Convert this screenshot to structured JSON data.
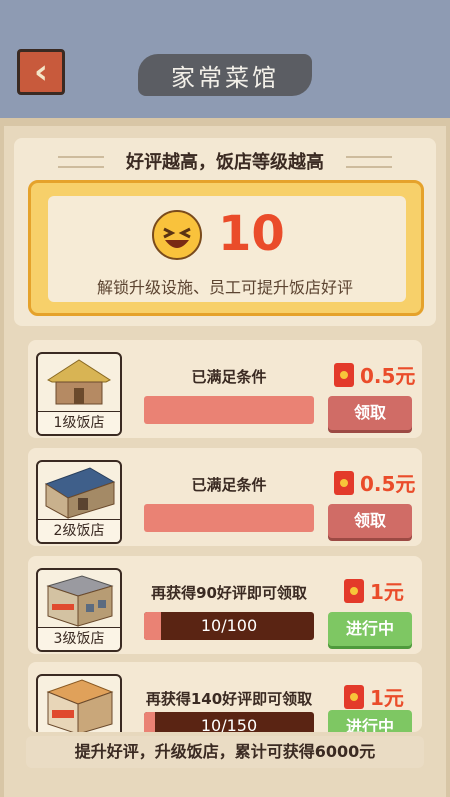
{
  "header": {
    "title": "家常菜馆",
    "back_icon": "chevron-left-icon"
  },
  "summary": {
    "title": "好评越高，饭店等级越高",
    "score": "10",
    "score_icon": "laughing-face-icon",
    "hint": "解锁升级设施、员工可提升饭店好评"
  },
  "cards": [
    {
      "label": "1级饭店",
      "condition": "已满足条件",
      "reward": "0.5元",
      "button": "领取",
      "state": "ready",
      "progress_text": "",
      "progress": 1.0
    },
    {
      "label": "2级饭店",
      "condition": "已满足条件",
      "reward": "0.5元",
      "button": "领取",
      "state": "ready",
      "progress_text": "",
      "progress": 1.0
    },
    {
      "label": "3级饭店",
      "condition": "再获得90好评即可领取",
      "reward": "1元",
      "button": "进行中",
      "state": "in_progress",
      "progress_text": "10/100",
      "progress": 0.1
    },
    {
      "label": "",
      "condition": "再获得140好评即可领取",
      "reward": "1元",
      "button": "进行中",
      "state": "in_progress",
      "progress_text": "10/150",
      "progress": 0.0667
    }
  ],
  "footer": {
    "text": "提升好评，升级饭店，累计可获得6000元"
  },
  "colors": {
    "top_bar": "#8e9bb3",
    "accent_red": "#ea4c2a",
    "claim_button": "#d06c66",
    "progress_button": "#7ec763"
  }
}
